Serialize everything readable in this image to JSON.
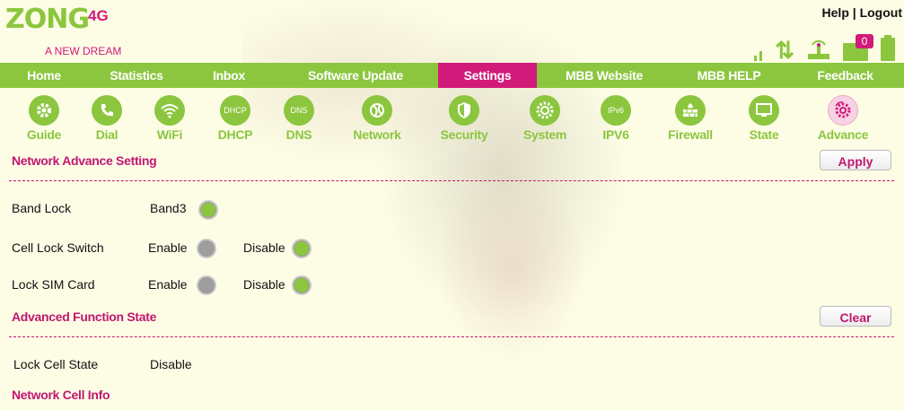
{
  "header": {
    "logo_main": "ZONG",
    "logo_4g": "4G",
    "tagline": "A NEW DREAM",
    "help": "Help",
    "separator": " | ",
    "logout": "Logout",
    "mail_count": "0"
  },
  "nav": [
    {
      "label": "Home"
    },
    {
      "label": "Statistics"
    },
    {
      "label": "Inbox"
    },
    {
      "label": "Software Update"
    },
    {
      "label": "Settings",
      "active": true
    },
    {
      "label": "MBB Website"
    },
    {
      "label": "MBB HELP"
    },
    {
      "label": "Feedback"
    }
  ],
  "subnav": [
    {
      "label": "Guide",
      "icon": "gear-icon"
    },
    {
      "label": "Dial",
      "icon": "phone-icon"
    },
    {
      "label": "WiFi",
      "icon": "wifi-icon"
    },
    {
      "label": "DHCP",
      "icon_text": "DHCP"
    },
    {
      "label": "DNS",
      "icon_text": "DNS"
    },
    {
      "label": "Network",
      "icon": "network-icon"
    },
    {
      "label": "Security",
      "icon": "shield-icon"
    },
    {
      "label": "System",
      "icon": "system-gear-icon"
    },
    {
      "label": "IPV6",
      "icon_text": "IPv6"
    },
    {
      "label": "Firewall",
      "icon": "firewall-icon"
    },
    {
      "label": "State",
      "icon": "monitor-icon"
    },
    {
      "label": "Advance",
      "icon": "advance-gear-icon",
      "active": true
    }
  ],
  "advance": {
    "title": "Network Advance Setting",
    "apply": "Apply",
    "band_lock": {
      "label": "Band Lock",
      "value": "Band3"
    },
    "cell_lock": {
      "label": "Cell Lock Switch",
      "enable": "Enable",
      "disable": "Disable",
      "selected": "Disable"
    },
    "sim_lock": {
      "label": "Lock SIM Card",
      "enable": "Enable",
      "disable": "Disable",
      "selected": "Disable"
    }
  },
  "function_state": {
    "title": "Advanced Function State",
    "clear": "Clear",
    "lock_cell_state": {
      "label": "Lock Cell State",
      "value": "Disable"
    }
  },
  "cell_info": {
    "title": "Network Cell Info"
  },
  "colors": {
    "brand_green": "#8cc63f",
    "brand_magenta": "#d11a7a",
    "background": "#fdfde6"
  }
}
